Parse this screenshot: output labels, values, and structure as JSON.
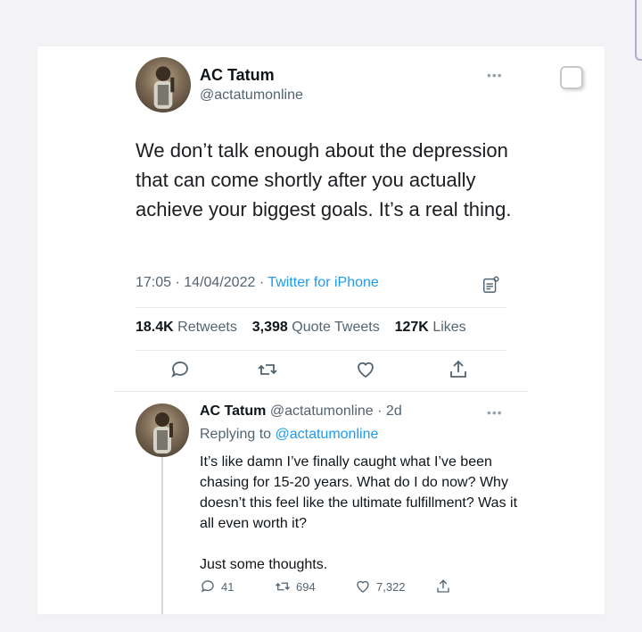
{
  "tweet": {
    "author_name": "AC Tatum",
    "author_handle": "@actatumonline",
    "text": "We don’t talk enough about the depression that can come shortly after you actually achieve your biggest goals. It’s a real thing.",
    "time": "17:05",
    "date": "14/04/2022",
    "source": "Twitter for iPhone",
    "retweets_count": "18.4K",
    "retweets_label": "Retweets",
    "quotes_count": "3,398",
    "quotes_label": "Quote Tweets",
    "likes_count": "127K",
    "likes_label": "Likes",
    "more_icon": "ellipsis-icon"
  },
  "reply": {
    "author_name": "AC Tatum",
    "author_handle": "@actatumonline",
    "age": "2d",
    "replying_prefix": "Replying to",
    "replying_to": "@actatumonline",
    "paragraph1": "It’s like damn I’ve finally caught what I’ve been chasing for 15-20 years. What do I do now? Why doesn’t this feel like the ultimate fulfillment? Was it all even worth it?",
    "paragraph2": "Just some thoughts.",
    "replies_count": "41",
    "retweets_count": "694",
    "likes_count": "7,322"
  },
  "colors": {
    "link": "#1d9bf0",
    "secondary_text": "#536471",
    "primary_text": "#0f1419"
  }
}
